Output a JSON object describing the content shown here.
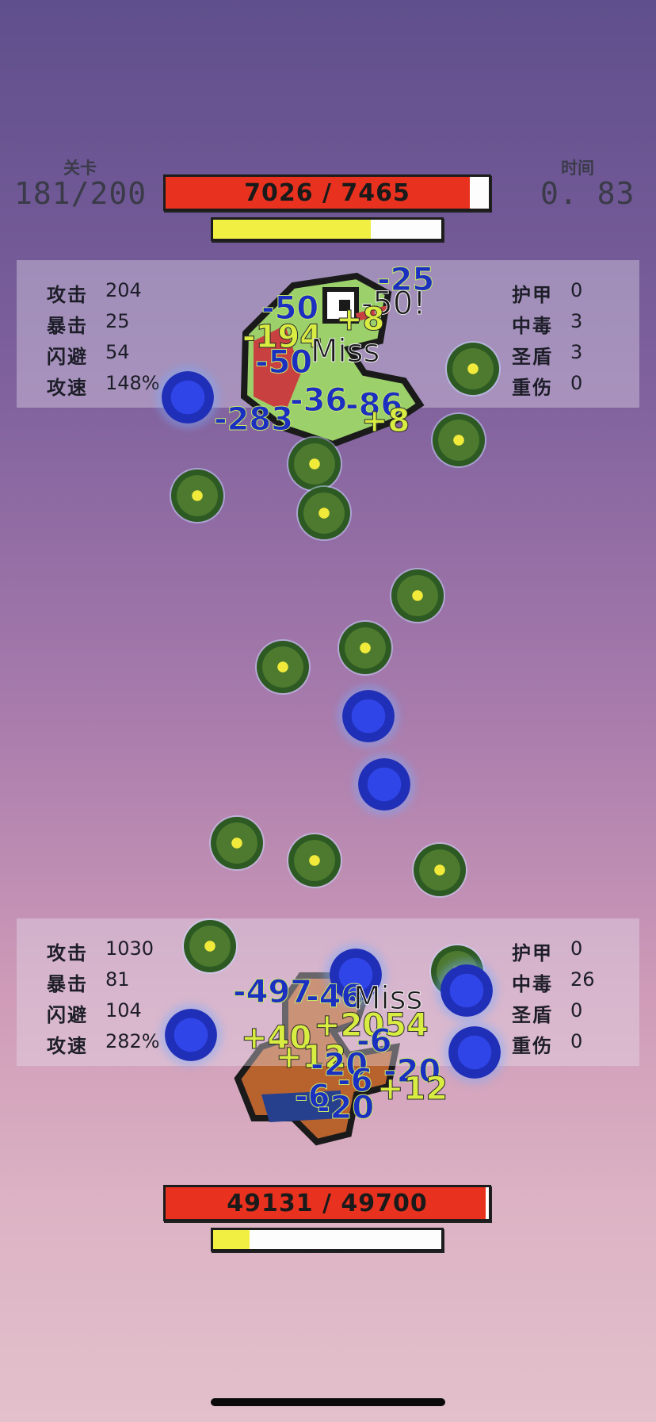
{
  "hud": {
    "level_label": "关卡",
    "level_value": "181/200",
    "time_label": "时间",
    "time_value": "0. 83"
  },
  "enemy": {
    "hp_text": "7026  /  7465",
    "hp_fraction": 0.941,
    "energy_fraction": 0.69,
    "hp_color": "#e8321f",
    "energy_color": "#f2ef43",
    "stats_left": [
      {
        "label": "攻击",
        "value": "204"
      },
      {
        "label": "暴击",
        "value": "25"
      },
      {
        "label": "闪避",
        "value": "54"
      },
      {
        "label": "攻速",
        "value": "148%"
      }
    ],
    "stats_right": [
      {
        "label": "护甲",
        "value": "0"
      },
      {
        "label": "中毒",
        "value": "3"
      },
      {
        "label": "圣盾",
        "value": "3"
      },
      {
        "label": "重伤",
        "value": "0"
      }
    ],
    "floating": [
      "-25",
      "-50",
      "-50!",
      "+8",
      "-194",
      "-50",
      "Miss",
      "-36",
      "-86",
      "-283",
      "+8"
    ]
  },
  "player": {
    "hp_text": "49131  /  49700",
    "hp_fraction": 0.989,
    "energy_fraction": 0.16,
    "hp_color": "#e8321f",
    "energy_color": "#f2ef43",
    "stats_left": [
      {
        "label": "攻击",
        "value": "1030"
      },
      {
        "label": "暴击",
        "value": "81"
      },
      {
        "label": "闪避",
        "value": "104"
      },
      {
        "label": "攻速",
        "value": "282%"
      }
    ],
    "stats_right": [
      {
        "label": "护甲",
        "value": "0"
      },
      {
        "label": "中毒",
        "value": "26"
      },
      {
        "label": "圣盾",
        "value": "0"
      },
      {
        "label": "重伤",
        "value": "0"
      }
    ],
    "floating": [
      "-497",
      "-46",
      "Miss",
      "+40",
      "+2054",
      "-6",
      "+12",
      "-20",
      "-6",
      "-20",
      "+12",
      "-6",
      "-20"
    ]
  },
  "icons": {
    "projectile_green": "green-orb-icon",
    "projectile_blue": "blue-orb-icon",
    "enemy_sprite": "frog-monster-icon",
    "player_sprite": "boar-warrior-icon"
  }
}
